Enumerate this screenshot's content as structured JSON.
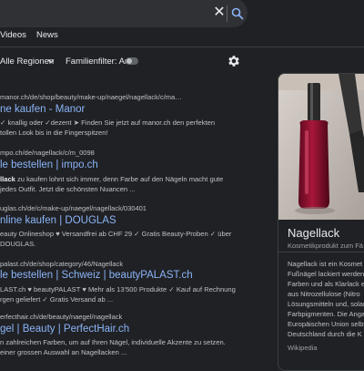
{
  "search": {
    "clear_icon": "close-icon",
    "search_icon": "search-icon"
  },
  "tabs": [
    {
      "label": "Videos"
    },
    {
      "label": "News"
    }
  ],
  "filters": {
    "region": "Alle Regionen",
    "family_filter": "Familienfilter: An",
    "settings_icon": "gear-icon"
  },
  "results": [
    {
      "url": "manor.ch/de/shop/beauty/make-up/naegel/nagellack/c/ma…",
      "title": "ne kaufen - Manor",
      "snippet": [
        "✓ knallig oder ✓dezent ➤ Finden Sie jetzt auf manor.ch den perfekten",
        "tollen Look bis in die Fingerspitzen!"
      ]
    },
    {
      "url": "mpo.ch/de/nagellack/c/m_0098",
      "title": "le bestellen | impo.ch",
      "snippet_bold": "llack",
      "snippet_rest": " zu kaufen lohnt sich immer, denn Farbe auf den Nägeln macht gute",
      "snippet": [
        "jedes Outfit. Jetzt die schönsten Nuancen ..."
      ]
    },
    {
      "url": "uglas.ch/de/c/make-up/naegel/nagellack/030401",
      "title": "nline kaufen | DOUGLAS",
      "snippet": [
        "eauty Onlineshop ♥ Versandfrei ab CHF 29 ✓ Gratis Beauty-Proben ✓ über",
        "DOUGLAS."
      ]
    },
    {
      "url": "palast.ch/de/shop/category/46/Nagellack",
      "title": "le bestellen | Schweiz | beautyPALAST.ch",
      "snippet": [
        "LAST.ch ♥ beautyPALAST ♥ Mehr als 13'500 Produkte ✓ Kauf auf Rechnung",
        "rgen geliefert ✓ Gratis Versand ab ..."
      ]
    },
    {
      "url": "erfecthair.ch/de/beauty/naegel/nagellack",
      "title": "gel | Beauty | PerfectHair.ch",
      "snippet": [
        "n zahlreichen Farben, um auf Ihren Nägel, individuelle Akzente zu setzen.",
        "einer grossen Auswahl an Nagellacken ..."
      ]
    }
  ],
  "knowledge_panel": {
    "title": "Nagellack",
    "subtitle": "Kosmetikprodukt zum Fä",
    "description_lines": [
      "Nagellack ist ein Kosmet",
      "Fußnägel lackiert werden",
      "Farben und als Klarlack e",
      "aus Nitrozellulose (Nitro",
      "Lösungsmitteln und, solan",
      "Farbpigmenten. Die Angab",
      "Europäischen Union selbt",
      "Deutschland durch die K"
    ],
    "source": "Wikipedia",
    "accent_color": "#8b1030"
  }
}
